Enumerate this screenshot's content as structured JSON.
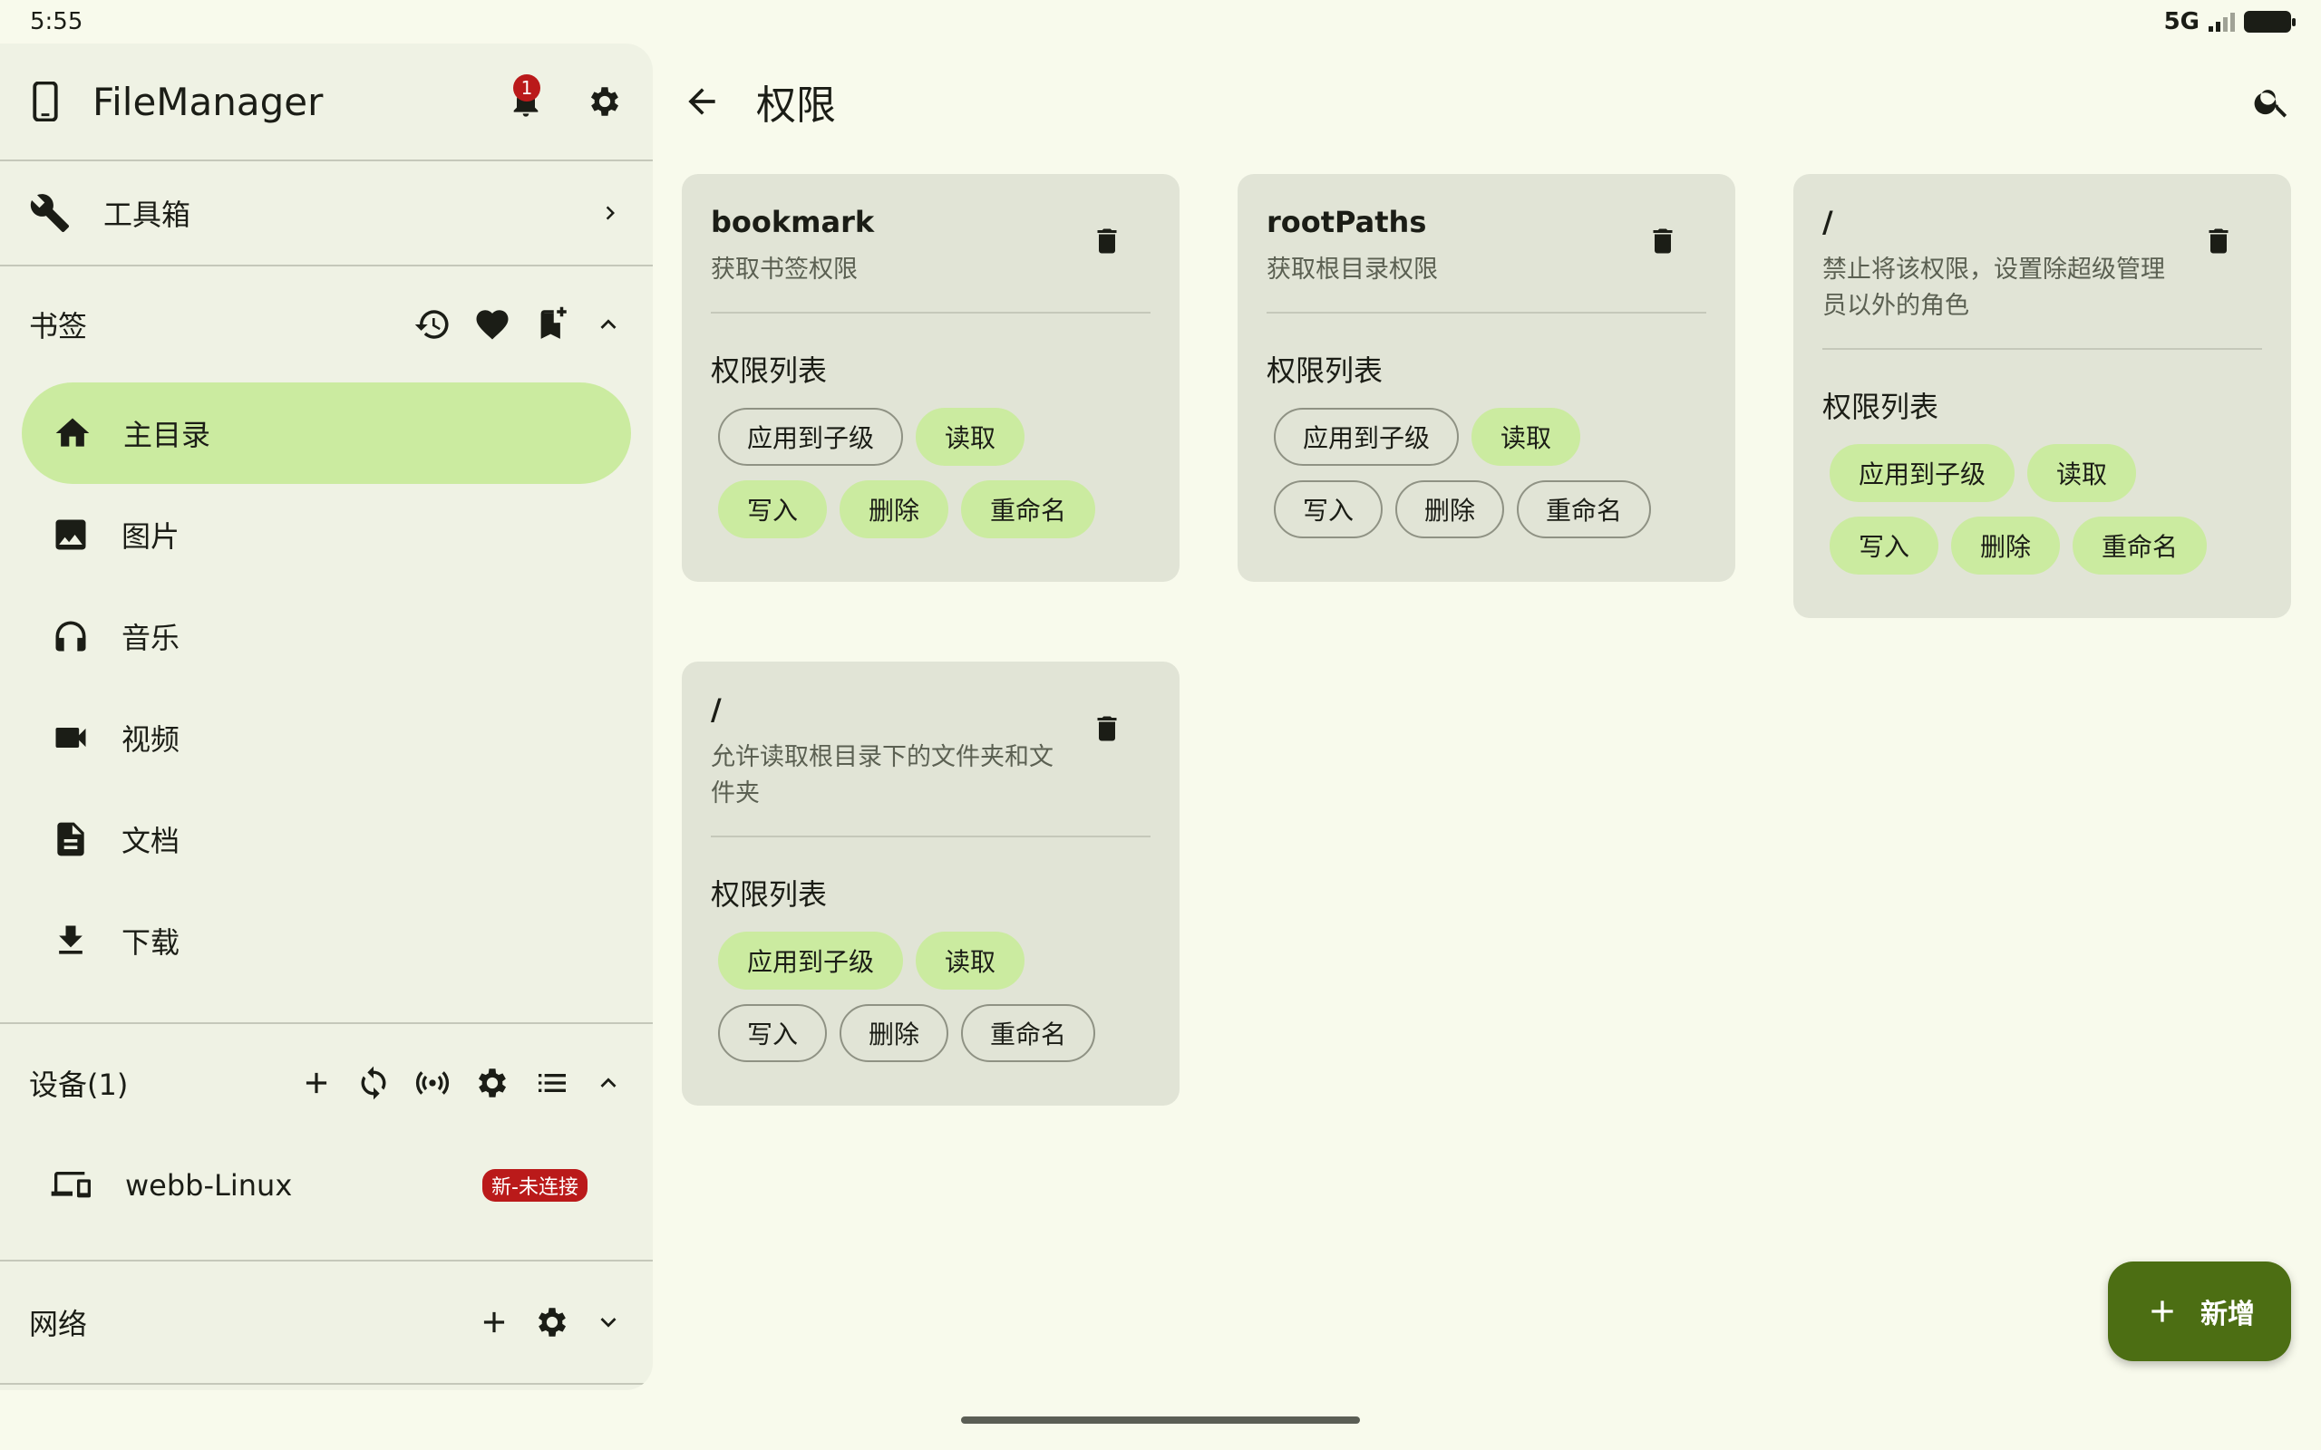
{
  "status": {
    "time": "5:55",
    "network": "5G"
  },
  "sidebar": {
    "app_title": "FileManager",
    "notification_count": "1",
    "toolbox_label": "工具箱",
    "bookmarks": {
      "header": "书签",
      "items": [
        {
          "label": "主目录",
          "icon": "home-icon",
          "active": true
        },
        {
          "label": "图片",
          "icon": "image-icon"
        },
        {
          "label": "音乐",
          "icon": "headphones-icon"
        },
        {
          "label": "视频",
          "icon": "video-icon"
        },
        {
          "label": "文档",
          "icon": "document-icon"
        },
        {
          "label": "下载",
          "icon": "download-icon"
        }
      ]
    },
    "devices": {
      "header": "设备(1)",
      "items": [
        {
          "label": "webb-Linux",
          "badge": "新-未连接"
        }
      ]
    },
    "network": {
      "header": "网络"
    }
  },
  "topbar": {
    "title": "权限"
  },
  "cards": [
    {
      "name": "bookmark",
      "desc": "获取书签权限",
      "perm_title": "权限列表",
      "chips": [
        {
          "label": "应用到子级",
          "on": false
        },
        {
          "label": "读取",
          "on": true
        },
        {
          "label": "写入",
          "on": true
        },
        {
          "label": "删除",
          "on": true
        },
        {
          "label": "重命名",
          "on": true
        }
      ]
    },
    {
      "name": "rootPaths",
      "desc": "获取根目录权限",
      "perm_title": "权限列表",
      "chips": [
        {
          "label": "应用到子级",
          "on": false
        },
        {
          "label": "读取",
          "on": true
        },
        {
          "label": "写入",
          "on": false
        },
        {
          "label": "删除",
          "on": false
        },
        {
          "label": "重命名",
          "on": false
        }
      ]
    },
    {
      "name": "/",
      "desc": "禁止将该权限，设置除超级管理员以外的角色",
      "perm_title": "权限列表",
      "chips": [
        {
          "label": "应用到子级",
          "on": true
        },
        {
          "label": "读取",
          "on": true
        },
        {
          "label": "写入",
          "on": true
        },
        {
          "label": "删除",
          "on": true
        },
        {
          "label": "重命名",
          "on": true
        }
      ]
    },
    {
      "name": "/",
      "desc": "允许读取根目录下的文件夹和文件夹",
      "perm_title": "权限列表",
      "chips": [
        {
          "label": "应用到子级",
          "on": true
        },
        {
          "label": "读取",
          "on": true
        },
        {
          "label": "写入",
          "on": false
        },
        {
          "label": "删除",
          "on": false
        },
        {
          "label": "重命名",
          "on": false
        }
      ]
    }
  ],
  "fab": {
    "label": "新增"
  },
  "colors": {
    "primary": "#4c6e13",
    "chip_on": "#cbeba0",
    "card": "#e1e4d6",
    "badge": "#ba1a1a"
  }
}
